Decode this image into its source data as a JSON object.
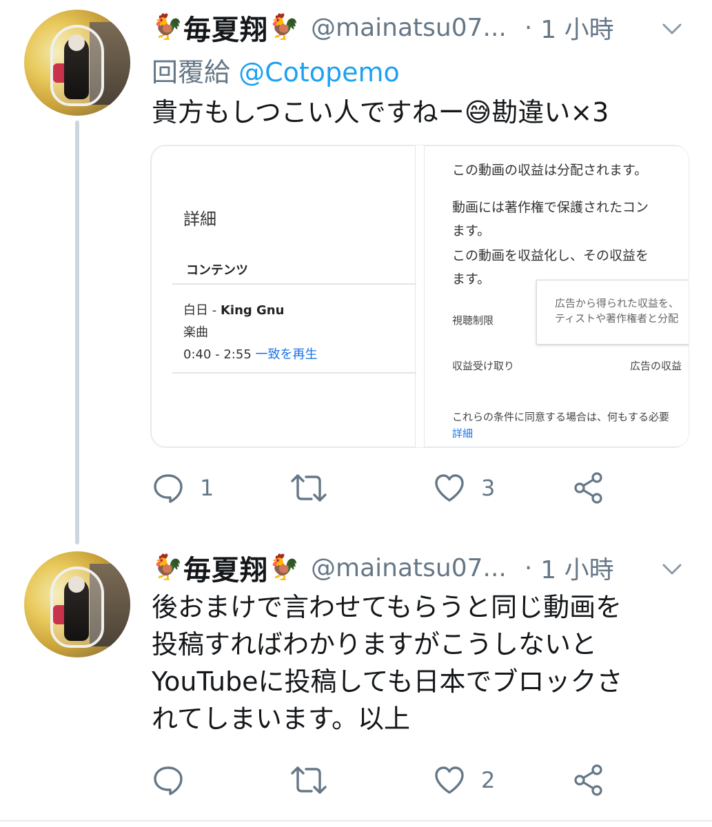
{
  "tweets": [
    {
      "name": "毎夏翔",
      "chicken_emoji": "🐓",
      "handle": "@mainatsu07...",
      "dot": "·",
      "time": "1 小時",
      "reply_label": "回覆給",
      "reply_mention": "@Cotopemo",
      "lines": [
        "貴方もしつこい人ですねー😅勘違い×3"
      ],
      "actions": {
        "reply_count": "1",
        "retweet_count": "",
        "like_count": "3"
      },
      "card": {
        "left": {
          "title": "詳細",
          "section": "コンテンツ",
          "song_title": "白日",
          "song_sep": " - ",
          "song_artist": "King Gnu",
          "type": "楽曲",
          "range": "0:40 - 2:55",
          "range_link": "一致を再生"
        },
        "right": {
          "line1": "この動画の収益は分配されます。",
          "line2": "動画には著作権で保護されたコン",
          "line3": "ます。",
          "line4": "この動画を収益化し、その収益を",
          "line5": "ます。",
          "label_view_limit": "視聴制限",
          "tooltip_line1": "広告から得られた収益を、",
          "tooltip_line2": "ティストや著作権者と分配",
          "label_revenue": "収益受け取り",
          "label_ad_revenue": "広告の収益",
          "footer": "これらの条件に同意する場合は、何もする必要",
          "footer_link": "詳細"
        }
      }
    },
    {
      "name": "毎夏翔",
      "chicken_emoji": "🐓",
      "handle": "@mainatsu07...",
      "dot": "·",
      "time": "1 小時",
      "lines": [
        "後おまけで言わせてもらうと同じ動画を",
        "投稿すればわかりますがこうしないと",
        "YouTubeに投稿しても日本でブロックさ",
        "れてしまいます。以上"
      ],
      "actions": {
        "reply_count": "",
        "retweet_count": "",
        "like_count": "2"
      }
    }
  ],
  "colors": {
    "text": "#14171a",
    "secondary": "#657786",
    "link": "#1da1f2",
    "thread_line": "#ccd6dd"
  },
  "icons": [
    "reply-icon",
    "retweet-icon",
    "like-icon",
    "share-icon",
    "caret-down-icon",
    "rooster-emoji"
  ]
}
